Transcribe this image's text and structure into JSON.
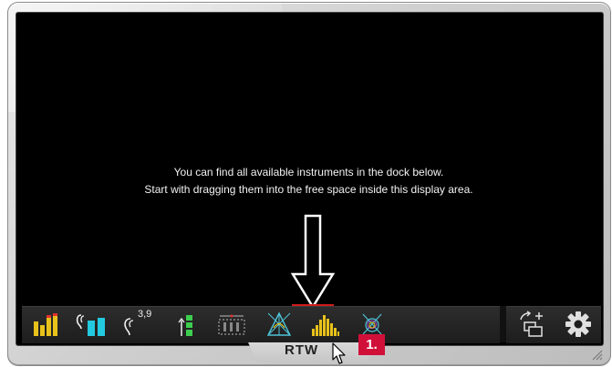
{
  "display": {
    "message_line1": "You can find all available instruments in the dock below.",
    "message_line2": "Start with dragging them into the free space inside this display area."
  },
  "dock": {
    "icons": [
      "level-meter-icon",
      "loudness-meter-icon",
      "loudness-value-icon",
      "tp-bar-icon",
      "surround-sound-icon",
      "vectorscope-icon",
      "rta-spectrum-icon",
      "radar-icon"
    ],
    "loudness_value_label": "3,9",
    "right_icons": [
      "add-display-icon",
      "settings-gear-icon"
    ]
  },
  "brand": {
    "logo_text": "RTW"
  },
  "annotation": {
    "step_label": "1."
  },
  "colors": {
    "accent_red": "#d1103a",
    "meter_yellow": "#e8c21a",
    "meter_cyan": "#22c9df",
    "meter_green": "#3ccf4e"
  }
}
